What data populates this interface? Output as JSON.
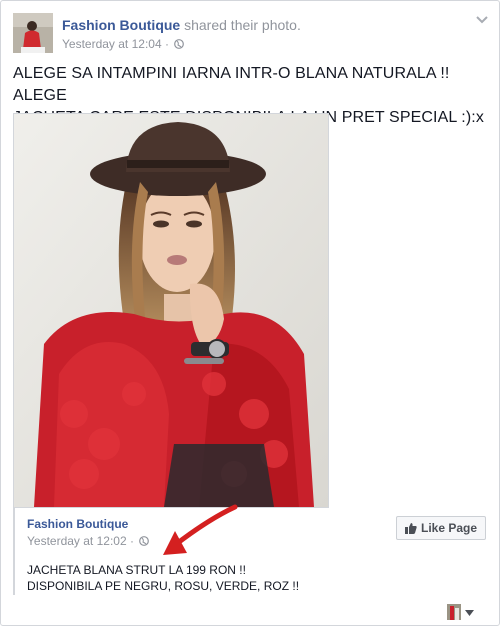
{
  "post": {
    "page_name": "Fashion Boutique",
    "action": "shared their photo.",
    "timestamp": "Yesterday at 12:04",
    "separator": "·",
    "text_line1": "ALEGE SA INTAMPINI IARNA INTR-O BLANA NATURALA !! ALEGE",
    "text_line2": "JACHETA CARE ESTE DISPONIBILA LA UN PRET SPECIAL :):x"
  },
  "shared": {
    "page_name": "Fashion Boutique",
    "timestamp": "Yesterday at 12:02",
    "separator": "·",
    "line1": "JACHETA BLANA STRUT LA 199 RON !!",
    "line2": "DISPONIBILA PE NEGRU, ROSU, VERDE, ROZ !!",
    "like_button": "Like Page"
  },
  "colors": {
    "link": "#3b5998",
    "arrow": "#d42020",
    "coat": "#c8202b"
  },
  "icons": [
    "globe-icon",
    "chevron-down-icon",
    "thumbs-up-icon",
    "caret-down-icon"
  ]
}
